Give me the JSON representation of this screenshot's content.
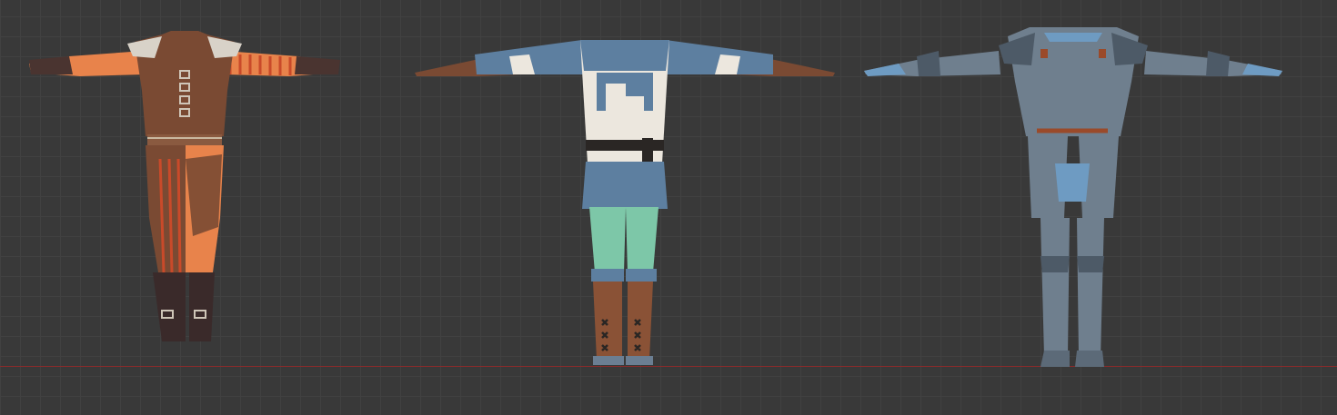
{
  "viewport": {
    "background": "#393939",
    "grid_color": "#414141",
    "ground_line_color": "#8a2b2b"
  },
  "outfits": [
    {
      "id": "leather-jerkin-outfit",
      "colors": {
        "leather": "#7a4a33",
        "orange": "#e8834b",
        "stripe": "#c94a2a",
        "boot": "#3a2a2a",
        "shoulder": "#d8d2c8"
      }
    },
    {
      "id": "scale-tunic-outfit",
      "colors": {
        "scale": "#5d7fa0",
        "cloth": "#ece7de",
        "legs": "#7dc7a8",
        "skin": "#7a4a33",
        "boot": "#8a5236"
      }
    },
    {
      "id": "plate-armor-outfit",
      "colors": {
        "plate": "#6f7f8e",
        "plate_dark": "#4d5a67",
        "scale": "#6e9bc2",
        "belt": "#9a4a2a"
      }
    }
  ]
}
